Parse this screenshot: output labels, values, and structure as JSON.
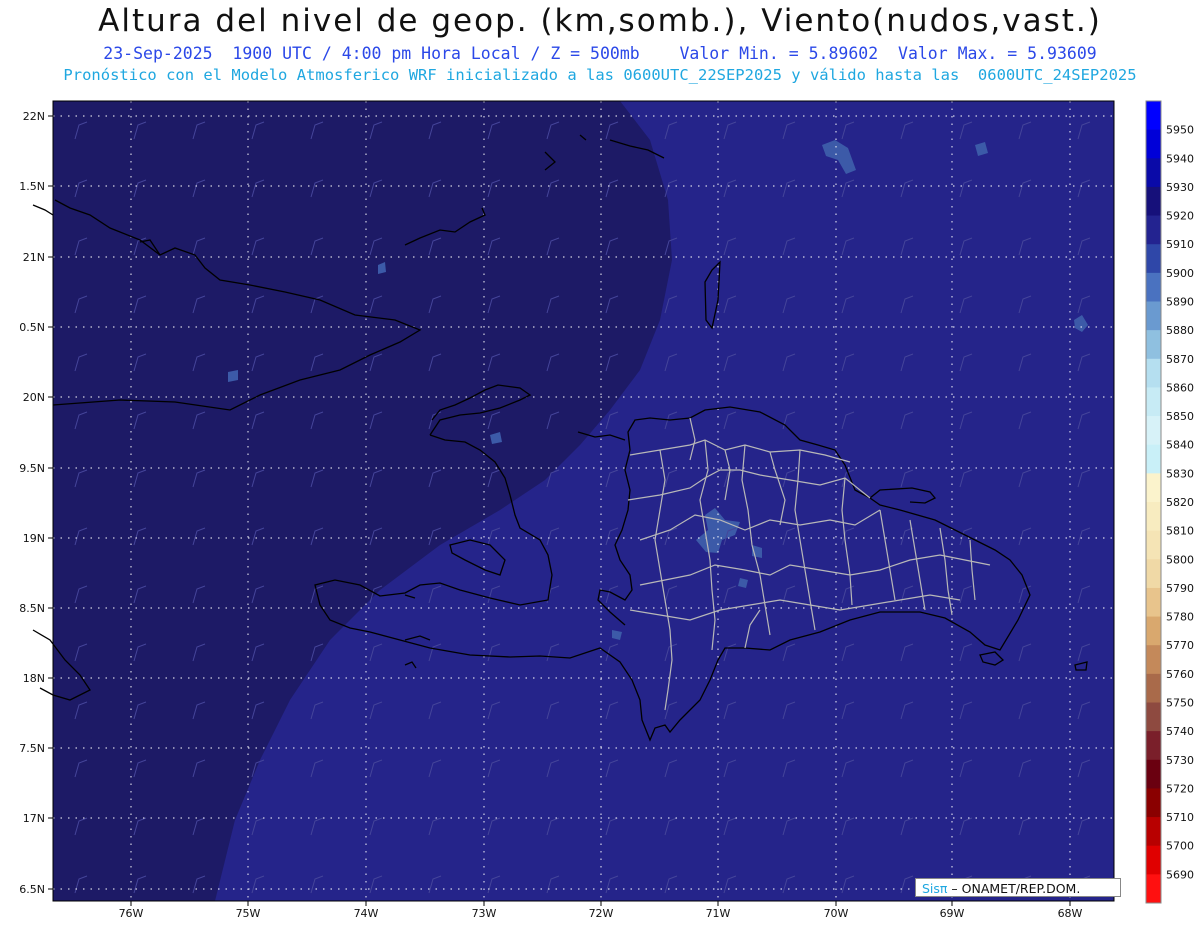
{
  "header": {
    "title": "Altura del nivel de geop. (km,somb.), Viento(nudos,vast.)",
    "line1": "23-Sep-2025  1900 UTC / 4:00 pm Hora Local / Z = 500mb    Valor Min. = 5.89602  Valor Max. = 5.93609",
    "line2": "Pronóstico con el Modelo Atmosferico WRF inicializado a las 0600UTC_22SEP2025 y válido hasta las  0600UTC_24SEP2025"
  },
  "axes": {
    "lon_labels": [
      "76W",
      "75W",
      "74W",
      "73W",
      "72W",
      "71W",
      "70W",
      "69W",
      "68W"
    ],
    "lat_labels": [
      "22N",
      "1.5N",
      "21N",
      "0.5N",
      "20N",
      "9.5N",
      "19N",
      "8.5N",
      "18N",
      "7.5N",
      "17N",
      "6.5N"
    ]
  },
  "colorbar": {
    "levels": [
      "5950",
      "5940",
      "5930",
      "5920",
      "5910",
      "5900",
      "5890",
      "5880",
      "5870",
      "5860",
      "5850",
      "5840",
      "5830",
      "5820",
      "5810",
      "5800",
      "5790",
      "5780",
      "5770",
      "5760",
      "5750",
      "5740",
      "5730",
      "5720",
      "5710",
      "5700",
      "5690"
    ],
    "colors": [
      "#0000ff",
      "#0000d8",
      "#0a0aa8",
      "#16107a",
      "#232390",
      "#2f47a8",
      "#4a72c0",
      "#6a9ad0",
      "#8fc0e0",
      "#b5dff0",
      "#c7ebf5",
      "#d7f2f8",
      "#c9f0f8",
      "#fbf3cc",
      "#f8ecc0",
      "#f5e4b5",
      "#f0d9a6",
      "#e8c48c",
      "#d9a86e",
      "#c4895a",
      "#a96a4a",
      "#8e4a40",
      "#7a1f2a",
      "#6a0010",
      "#8a0000",
      "#b80000",
      "#e00000",
      "#ff1010"
    ]
  },
  "credit": {
    "sis": "Sisπ",
    "rest": " – ONAMET/REP.DOM."
  },
  "colors": {
    "dark_region": "#1d1a66",
    "mid_region": "#25248a",
    "light_patch": "#3c5aa8",
    "coast": "#000000",
    "provinces": "#b8b8b8"
  }
}
